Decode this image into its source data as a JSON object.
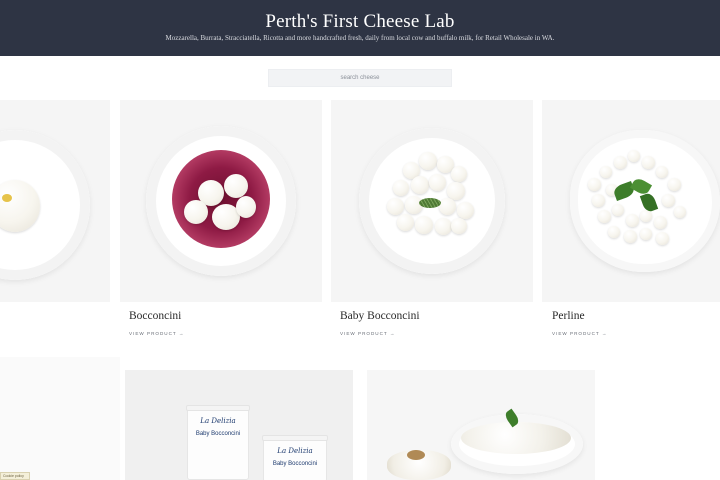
{
  "header": {
    "title": "Perth's First Cheese Lab",
    "tagline": "Mozzarella, Burrata, Stracciatella, Ricotta and more handcrafted fresh, daily from local cow and buffalo milk, for Retail Wholesale in WA."
  },
  "search": {
    "placeholder": "search cheese"
  },
  "products": [
    {
      "name": "Bocconcini",
      "link": "VIEW PRODUCT →"
    },
    {
      "name": "Baby Bocconcini",
      "link": "VIEW PRODUCT →"
    },
    {
      "name": "Perline",
      "link": "VIEW PRODUCT →"
    }
  ],
  "packaging": {
    "brand": "La Delizia",
    "product": "Baby Bocconcini"
  },
  "cookie_tab": {
    "label": "Cookie policy"
  }
}
